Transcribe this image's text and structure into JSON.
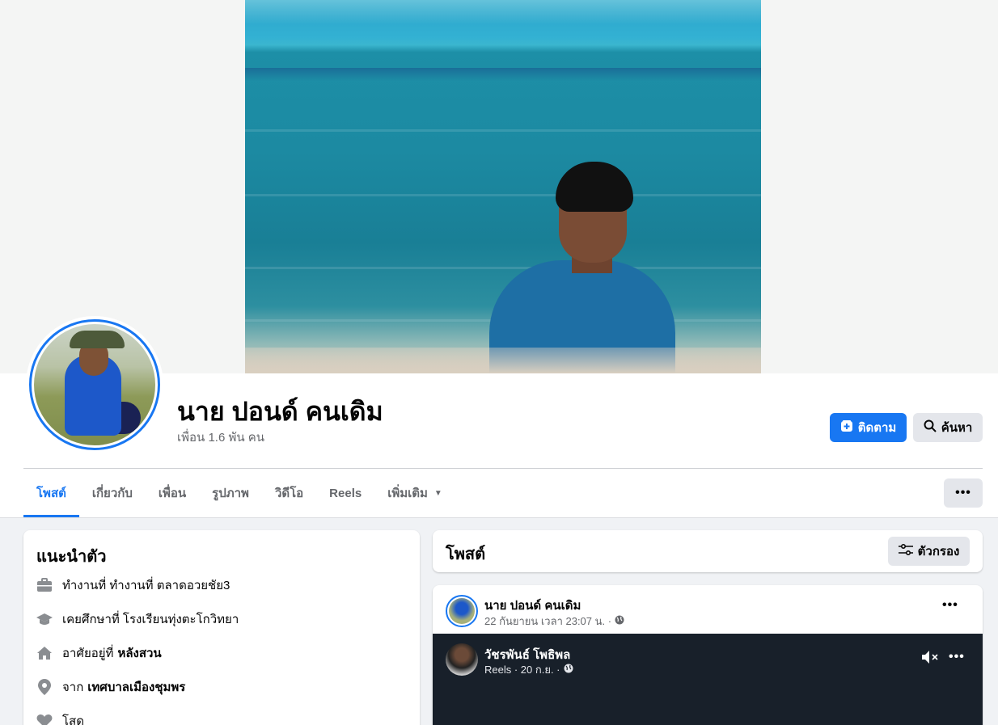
{
  "profile": {
    "name": "นาย ปอนด์ คนเดิม",
    "friends": "เพื่อน 1.6 พัน คน",
    "follow_label": "ติดตาม",
    "search_label": "ค้นหา",
    "more_label": "•••"
  },
  "tabs": [
    {
      "label": "โพสต์"
    },
    {
      "label": "เกี่ยวกับ"
    },
    {
      "label": "เพื่อน"
    },
    {
      "label": "รูปภาพ"
    },
    {
      "label": "วิดีโอ"
    },
    {
      "label": "Reels"
    },
    {
      "label": "เพิ่มเติม"
    }
  ],
  "intro": {
    "title": "แนะนำตัว",
    "items": [
      {
        "icon": "briefcase-icon",
        "text": "ทำงานที่ ทำงานที่ ตลาดอวยชัย3",
        "bold": ""
      },
      {
        "icon": "graduation-cap-icon",
        "text": "เคยศึกษาที่ โรงเรียนทุ่งตะโกวิทยา",
        "bold": ""
      },
      {
        "icon": "home-icon",
        "text": "อาศัยอยู่ที่",
        "bold": "หลังสวน"
      },
      {
        "icon": "location-pin-icon",
        "text": "จาก",
        "bold": "เทศบาลเมืองชุมพร"
      },
      {
        "icon": "heart-icon",
        "text": "โสด",
        "bold": ""
      }
    ]
  },
  "posts": {
    "title": "โพสต์",
    "filter_label": "ตัวกรอง"
  },
  "post": {
    "author": "นาย ปอนด์ คนเดิม",
    "meta": "22 กันยายน เวลา 23:07 น. ·",
    "menu": "•••",
    "reel": {
      "author": "วัชรพันธ์ โพธิพล",
      "meta": "Reels · 20 ก.ย. ·",
      "menu": "•••"
    }
  },
  "colors": {
    "accent": "#1877f2",
    "background": "#f0f2f5",
    "reel_bg": "#18202a"
  }
}
